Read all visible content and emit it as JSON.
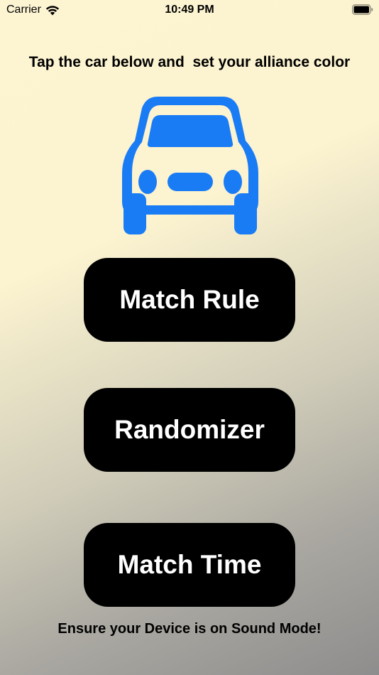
{
  "status_bar": {
    "carrier": "Carrier",
    "time": "10:49 PM",
    "wifi_icon": "wifi-icon",
    "battery_icon": "battery-full-icon"
  },
  "instruction": "Tap the car below and  set your alliance color",
  "car": {
    "icon": "car-icon",
    "color": "#1a7cf5"
  },
  "buttons": [
    {
      "label": "Match Rule"
    },
    {
      "label": "Randomizer"
    },
    {
      "label": "Match Time"
    }
  ],
  "footer": "Ensure your Device is on Sound Mode!"
}
